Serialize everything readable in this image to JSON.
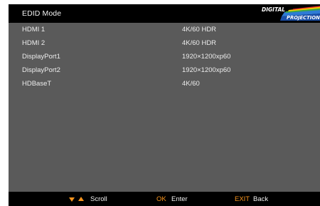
{
  "header": {
    "title": "EDID Mode",
    "logo": {
      "top_text": "DIGITAL",
      "bottom_text": "PROJECTION"
    }
  },
  "rows": [
    {
      "name": "HDMI 1",
      "value": "4K/60 HDR"
    },
    {
      "name": "HDMI 2",
      "value": "4K/60 HDR"
    },
    {
      "name": "DisplayPort1",
      "value": "1920×1200xp60"
    },
    {
      "name": "DisplayPort2",
      "value": "1920×1200xp60"
    },
    {
      "name": "HDBaseT",
      "value": "4K/60"
    }
  ],
  "footer": {
    "scroll_icon": "up-down-arrows-icon",
    "scroll_label": "Scroll",
    "ok_key": "OK",
    "ok_label": "Enter",
    "exit_key": "EXIT",
    "exit_label": "Back"
  },
  "colors": {
    "background": "#5a5a5a",
    "bar": "#000000",
    "accent": "#f7941d",
    "text": "#ececec"
  }
}
